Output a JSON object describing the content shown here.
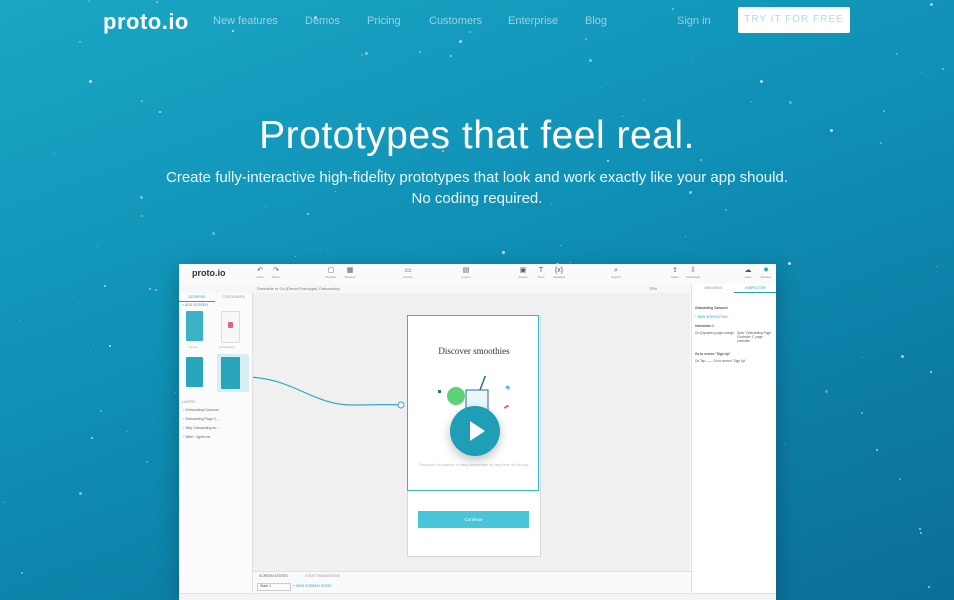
{
  "nav": {
    "logo": "proto.io",
    "links": [
      "New features",
      "Demos",
      "Pricing",
      "Customers",
      "Enterprise",
      "Blog"
    ],
    "signin": "Sign in",
    "cta": "TRY IT FOR FREE"
  },
  "hero": {
    "title": "Prototypes that feel real.",
    "subtitle_line1": "Create fully-interactive high-fidelity prototypes that look and work exactly like your app should.",
    "subtitle_line2": "No coding required."
  },
  "app": {
    "logo": "proto.io",
    "toolbar": [
      {
        "icon": "undo-icon",
        "label": "Undo"
      },
      {
        "icon": "redo-icon",
        "label": "Redo"
      },
      {
        "icon": "preview-icon",
        "label": "Preview"
      },
      {
        "icon": "grid-icon",
        "label": "Screens"
      },
      {
        "icon": "device-icon",
        "label": "Device"
      },
      {
        "icon": "layers-icon",
        "label": "Layers"
      },
      {
        "icon": "assets-icon",
        "label": "Assets"
      },
      {
        "icon": "text-icon",
        "label": "Texts"
      },
      {
        "icon": "variables-icon",
        "label": "Variables"
      },
      {
        "icon": "search-icon",
        "label": "Search"
      },
      {
        "icon": "share-icon",
        "label": "Share"
      },
      {
        "icon": "download-icon",
        "label": "Download"
      },
      {
        "icon": "save-icon",
        "label": "Save"
      },
      {
        "icon": "settings-icon",
        "label": "Preview"
      }
    ],
    "breadcrumb": "Smoothie to Go (Demo Prototype)   Onboarding",
    "left_tabs": [
      "SCREENS",
      "CONTAINERS"
    ],
    "add_screen": "ADD SCREEN",
    "screens": [
      "Home",
      "Onboarding",
      "",
      ""
    ],
    "layers_label": "LAYERS",
    "layers": [
      "Onboarding Carousel",
      "Onboarding Page C...",
      "Skip Onboarding bu...",
      "Wide - lights me"
    ],
    "phone_title": "Discover smoothies",
    "phone_desc": "Discover thousands of tasty smoothies for any time of the day",
    "continue_label": "Continue",
    "right_tabs": [
      "LIBRARIES",
      "INSPECTOR"
    ],
    "inspector": {
      "title": "Onboarding Carousel",
      "new_interaction": "NEW INTERACTION",
      "interaction_label": "Interaction 1",
      "interaction_line1": "On (Dynamic) page change",
      "interaction_line2": "Sync \"Onboarding Page Controller 1\" page controller",
      "goto_label": "Go to screen \"Sign Up\"",
      "goto_line": "On Tap  ——  Go to screen \"Sign Up\""
    },
    "bottom_tabs": [
      "SCREEN STATES",
      "STATE TRANSITIONS"
    ],
    "state_select": "State 1",
    "new_state": "NEW SCREEN STATE",
    "zoom": "75%"
  }
}
